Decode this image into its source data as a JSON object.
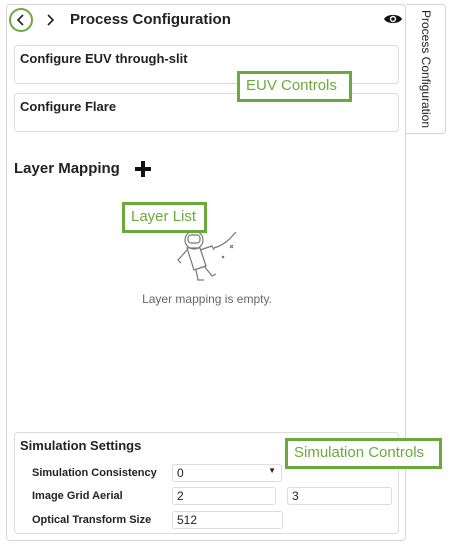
{
  "header": {
    "title": "Process Configuration",
    "back_icon": "chevron-left-icon",
    "forward_icon": "chevron-right-icon",
    "visibility_icon": "eye-icon"
  },
  "side_tab": {
    "label": "Process Configuration"
  },
  "sections": {
    "euv": {
      "title": "Configure EUV through-slit"
    },
    "flare": {
      "title": "Configure Flare"
    }
  },
  "layer_mapping": {
    "heading": "Layer Mapping",
    "add_icon": "plus-icon",
    "empty_text": "Layer mapping is empty.",
    "empty_icon": "astronaut-icon"
  },
  "simulation": {
    "title": "Simulation Settings",
    "consistency": {
      "label": "Simulation Consistency",
      "value": "0"
    },
    "grid": {
      "label": "Image Grid Aerial",
      "value1": "2",
      "value2": "3"
    },
    "optical": {
      "label": "Optical Transform Size",
      "value": "512"
    }
  },
  "callouts": {
    "euv": "EUV Controls",
    "layer": "Layer List",
    "sim": "Simulation Controls"
  },
  "colors": {
    "accent": "#6aaa3a",
    "border": "#d6d6d6"
  }
}
